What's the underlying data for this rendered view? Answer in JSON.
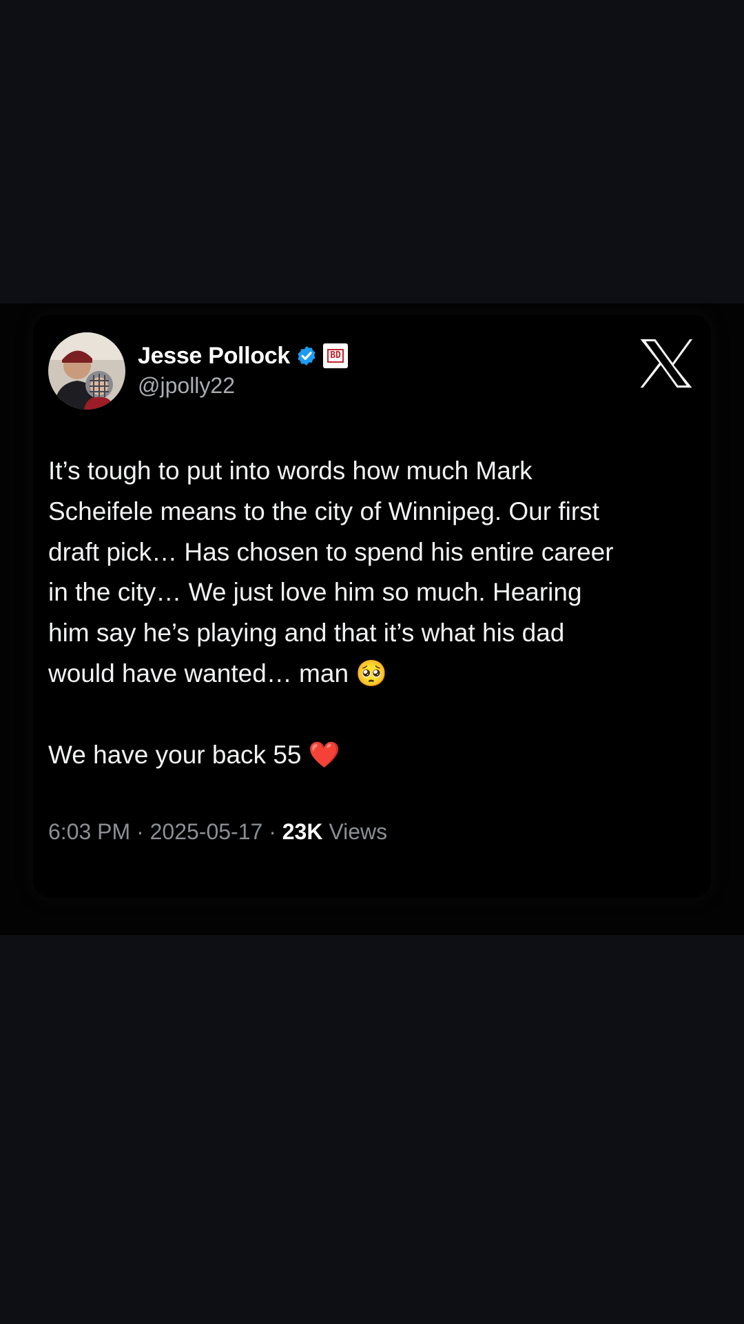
{
  "tweet": {
    "author_name": "Jesse Pollock",
    "handle": "@jpolly22",
    "affiliate_badge_text": "BD",
    "body_lines": [
      "It’s tough to put into words how much Mark",
      "Scheifele means to the city of Winnipeg. Our first",
      "draft pick… Has chosen to spend his entire career",
      "in the city… We just love him so much. Hearing",
      "him say he’s playing and that it’s what his dad",
      "would have wanted… man"
    ],
    "pleading_emoji": "🥺",
    "closing_line": "We have your back 55",
    "heart_emoji": "❤️",
    "time": "6:03 PM",
    "separator": "·",
    "date": "2025-05-17",
    "views_count": "23K",
    "views_label": "Views"
  },
  "icons": {
    "verified": "verified-badge-icon",
    "platform_logo": "x-logo-icon"
  },
  "colors": {
    "page_background": "#0d0f14",
    "card_background": "#000000",
    "verified_blue": "#1d9bf0",
    "muted_text": "#8b8f94",
    "heart_red": "#e0162b"
  }
}
